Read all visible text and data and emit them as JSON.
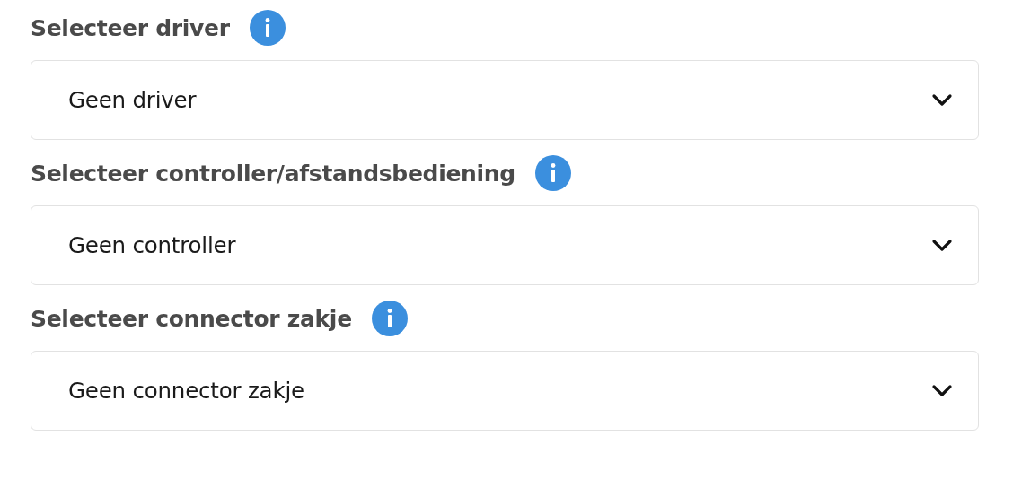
{
  "fields": [
    {
      "label": "Selecteer driver",
      "value": "Geen driver"
    },
    {
      "label": "Selecteer controller/afstandsbediening",
      "value": "Geen controller"
    },
    {
      "label": "Selecteer connector zakje",
      "value": "Geen connector zakje"
    }
  ]
}
